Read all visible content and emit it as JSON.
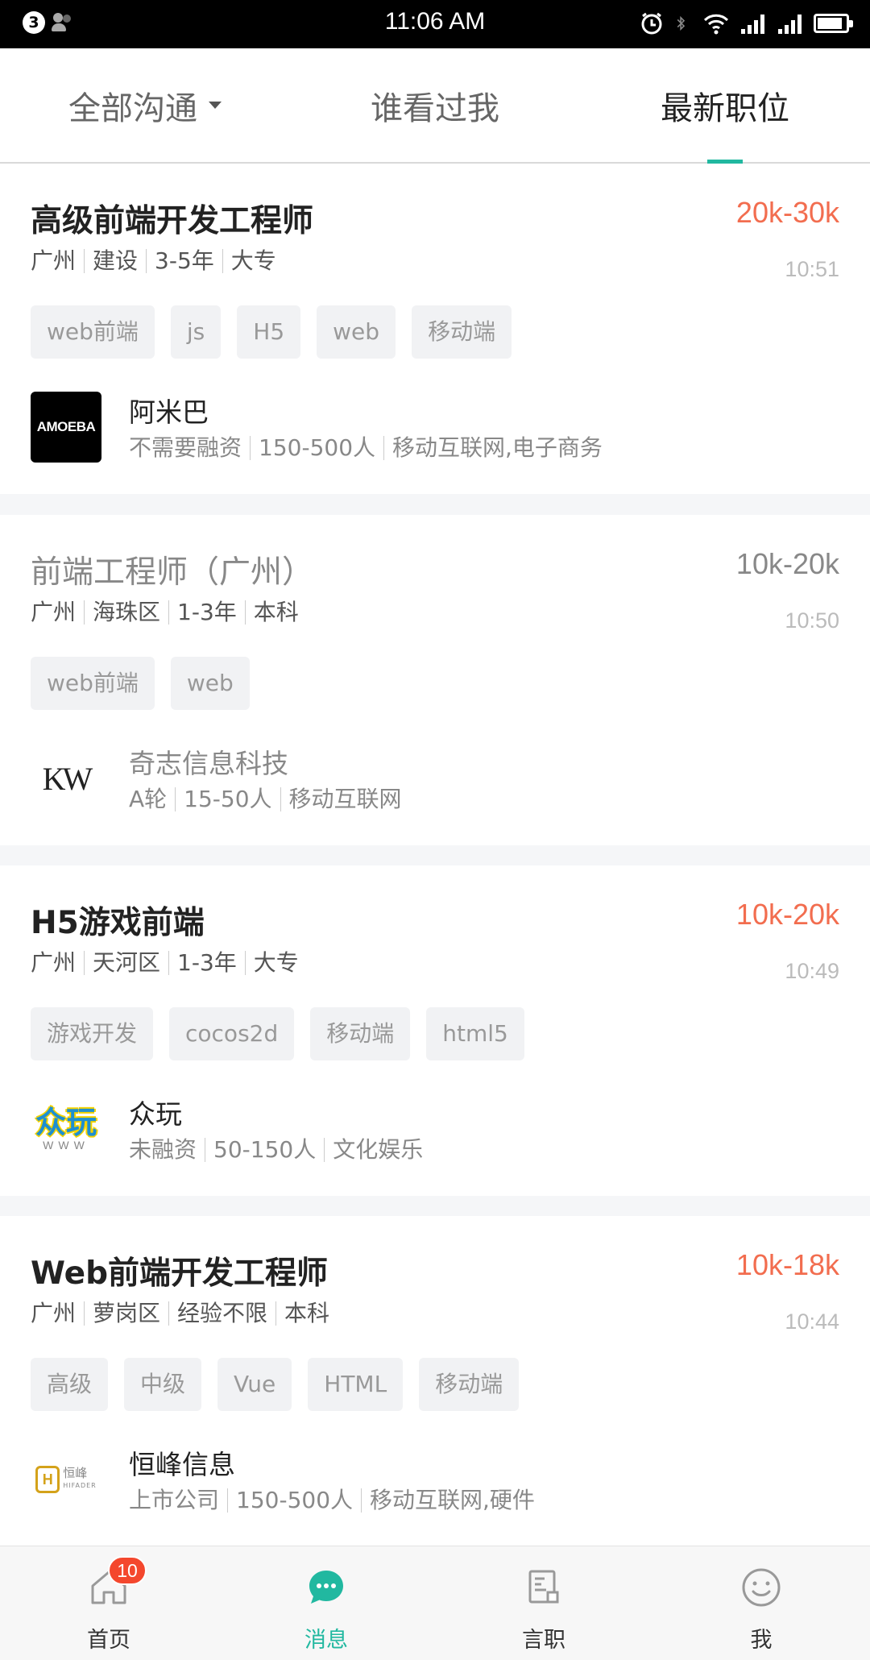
{
  "status_bar": {
    "notification_count": "3",
    "time": "11:06 AM",
    "icons": [
      "alarm-icon",
      "bluetooth-icon",
      "wifi-icon",
      "signal-icon",
      "signal-2-icon",
      "battery-icon"
    ]
  },
  "top_tabs": [
    {
      "label": "全部沟通",
      "has_dropdown": true,
      "active": false
    },
    {
      "label": "谁看过我",
      "active": false
    },
    {
      "label": "最新职位",
      "active": true
    }
  ],
  "colors": {
    "accent": "#21b8a0",
    "salary": "#f26d4f",
    "badge": "#f4472d"
  },
  "jobs": [
    {
      "title": "高级前端开发工程师",
      "salary": "20k-30k",
      "meta": [
        "广州",
        "建设",
        "3-5年",
        "大专"
      ],
      "time": "10:51",
      "tags": [
        "web前端",
        "js",
        "H5",
        "web",
        "移动端"
      ],
      "company": "阿米巴",
      "company_meta": [
        "不需要融资",
        "150-500人",
        "移动互联网,电子商务"
      ],
      "logo_text": "AMOEBA",
      "viewed": false
    },
    {
      "title": "前端工程师（广州）",
      "salary": "10k-20k",
      "meta": [
        "广州",
        "海珠区",
        "1-3年",
        "本科"
      ],
      "time": "10:50",
      "tags": [
        "web前端",
        "web"
      ],
      "company": "奇志信息科技",
      "company_meta": [
        "A轮",
        "15-50人",
        "移动互联网"
      ],
      "logo_text": "KW",
      "viewed": true
    },
    {
      "title": "H5游戏前端",
      "salary": "10k-20k",
      "meta": [
        "广州",
        "天河区",
        "1-3年",
        "大专"
      ],
      "time": "10:49",
      "tags": [
        "游戏开发",
        "cocos2d",
        "移动端",
        "html5"
      ],
      "company": "众玩",
      "company_meta": [
        "未融资",
        "50-150人",
        "文化娱乐"
      ],
      "logo_text": "众玩",
      "logo_subtext": "WWW",
      "viewed": false
    },
    {
      "title": "Web前端开发工程师",
      "salary": "10k-18k",
      "meta": [
        "广州",
        "萝岗区",
        "经验不限",
        "本科"
      ],
      "time": "10:44",
      "tags": [
        "高级",
        "中级",
        "Vue",
        "HTML",
        "移动端"
      ],
      "company": "恒峰信息",
      "company_meta": [
        "上市公司",
        "150-500人",
        "移动互联网,硬件"
      ],
      "logo_text": "恒峰",
      "logo_subtext": "HIFADER",
      "viewed": false
    }
  ],
  "bottom_nav": [
    {
      "label": "首页",
      "icon": "home-icon",
      "badge": "10",
      "active": false
    },
    {
      "label": "消息",
      "icon": "chat-icon",
      "active": true
    },
    {
      "label": "言职",
      "icon": "document-icon",
      "active": false
    },
    {
      "label": "我",
      "icon": "smiley-icon",
      "active": false
    }
  ]
}
